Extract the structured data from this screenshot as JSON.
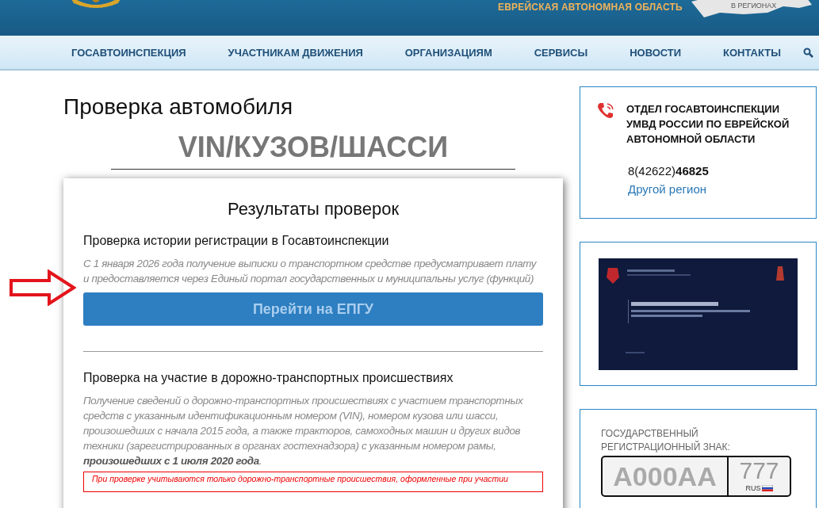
{
  "header": {
    "region": "ЕВРЕЙСКАЯ АВТОНОМНАЯ ОБЛАСТЬ",
    "map_label": "В РЕГИОНАХ"
  },
  "nav": {
    "items": [
      {
        "label": "ГОСАВТОИНСПЕКЦИЯ"
      },
      {
        "label": "УЧАСТНИКАМ ДВИЖЕНИЯ"
      },
      {
        "label": "ОРГАНИЗАЦИЯМ"
      },
      {
        "label": "СЕРВИСЫ"
      },
      {
        "label": "НОВОСТИ"
      },
      {
        "label": "КОНТАКТЫ"
      }
    ]
  },
  "page_title": "Проверка автомобиля",
  "subtitle": "VIN/КУЗОВ/ШАССИ",
  "results": {
    "title": "Результаты проверок",
    "sections": [
      {
        "heading": "Проверка истории регистрации в Госавтоинспекции",
        "text": "С 1 января 2026 года получение выписки о транспортном средстве предусматривает плату и предоставляется через Единый портал государственных и муниципальны услуг (функций)",
        "button": "Перейти на ЕПГУ"
      },
      {
        "heading": "Проверка на участие в дорожно-транспортных происшествиях",
        "text": "Получение сведений о дорожно-транспортных происшествиях с участием транспортных средств с указанным идентификационным номером (VIN), номером кузова или шасси, произошедших с начала 2015 года, а также тракторов, самоходных машин и других видов техники (зарегистрированных в органах гостехнадзора) с указанным номером рамы, **произошедших с 1 июля 2020 года**.",
        "notice": "При проверке учитываются только дорожно-транспортные происшествия, оформленные при участии"
      }
    ]
  },
  "contact": {
    "title": "ОТДЕЛ ГОСАВТОИНСПЕКЦИИ УМВД РОССИИ ПО ЕВРЕЙСКОЙ АВТОНОМНОЙ ОБЛАСТИ",
    "phone": "8(42622)**46825**",
    "link": "Другой регион"
  },
  "plate": {
    "label": "ГОСУДАРСТВЕННЫЙ РЕГИСТРАЦИОННЫЙ ЗНАК:",
    "number": "А000АА",
    "region": "777",
    "country": "RUS"
  }
}
